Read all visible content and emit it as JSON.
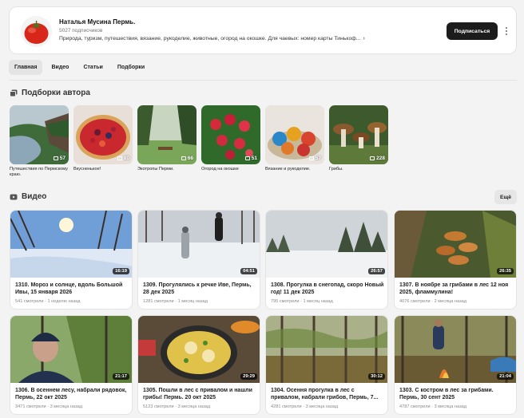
{
  "channel": {
    "name": "Наталья Мусина Пермь.",
    "subscribers": "5027 подписчиков",
    "description": "Природа, туризм, путешествия, вязание, рукоделие, животные, огород на окошке. Для чаевых: номер карты Тинькоф...",
    "description_more_icon": "chevron-right-icon",
    "subscribe_label": "Подписаться",
    "more_icon": "vertical-dots-icon",
    "avatar_icon": "tomato-avatar"
  },
  "tabs": [
    {
      "label": "Главная",
      "active": true
    },
    {
      "label": "Видео",
      "active": false
    },
    {
      "label": "Статьи",
      "active": false
    },
    {
      "label": "Подборки",
      "active": false
    }
  ],
  "playlists_section": {
    "title": "Подборки автора",
    "icon": "playlist-stack-icon",
    "items": [
      {
        "title": "Путешествия по Пермскому краю.",
        "count": "57",
        "scene": "river"
      },
      {
        "title": "Вкусненькое!",
        "count": "80",
        "scene": "pie"
      },
      {
        "title": "Экотропы Перми.",
        "count": "66",
        "scene": "meadow"
      },
      {
        "title": "Огород на окошке",
        "count": "51",
        "scene": "radish"
      },
      {
        "title": "Вязание и рукоделие.",
        "count": "57",
        "scene": "yarn"
      },
      {
        "title": "Грибы.",
        "count": "228",
        "scene": "mushrooms"
      }
    ]
  },
  "videos_section": {
    "title": "Видео",
    "icon": "video-play-icon",
    "all_label": "Ещё",
    "items": [
      {
        "title": "1310. Мороз и солнце, вдоль Большой Ивы, 15 января 2026",
        "views": "541 смотрели",
        "ago": "1 неделю назад",
        "duration": "16:19",
        "scene": "winter-sun"
      },
      {
        "title": "1309. Прогулялись к речке Иве, Пермь, 28 дек 2025",
        "views": "1281 смотрели",
        "ago": "1 месяц назад",
        "duration": "04:51",
        "scene": "winter-walk"
      },
      {
        "title": "1308. Прогулка в снегопад, скоро Новый год! 11 дек 2025",
        "views": "795 смотрели",
        "ago": "1 месяц назад",
        "duration": "26:57",
        "scene": "snowfall"
      },
      {
        "title": "1307. В ноябре за грибами в лес 12 ноя 2025, фламмулина!",
        "views": "4076 смотрели",
        "ago": "2 месяца назад",
        "duration": "26:35",
        "scene": "flammulina"
      },
      {
        "title": "1306. В осеннем лесу, набрали рядовок, Пермь, 22 окт 2025",
        "views": "3471 смотрели",
        "ago": "3 месяца назад",
        "duration": "21:17",
        "scene": "autumn-selfie"
      },
      {
        "title": "1305. Пошли в лес с привалом и нашли грибы! Пермь. 20 окт 2025",
        "views": "5123 смотрели",
        "ago": "3 месяца назад",
        "duration": "29:29",
        "scene": "fried-eggs"
      },
      {
        "title": "1304. Осення прогулка в лес с привалом, набрали грибов, Пермь, 7...",
        "views": "4281 смотрели",
        "ago": "3 месяца назад",
        "duration": "30:12",
        "scene": "autumn-forest"
      },
      {
        "title": "1303. С костром в лес за грибами. Пермь, 30 сент 2025",
        "views": "4787 смотрели",
        "ago": "3 месяца назад",
        "duration": "21:04",
        "scene": "campfire"
      }
    ]
  }
}
